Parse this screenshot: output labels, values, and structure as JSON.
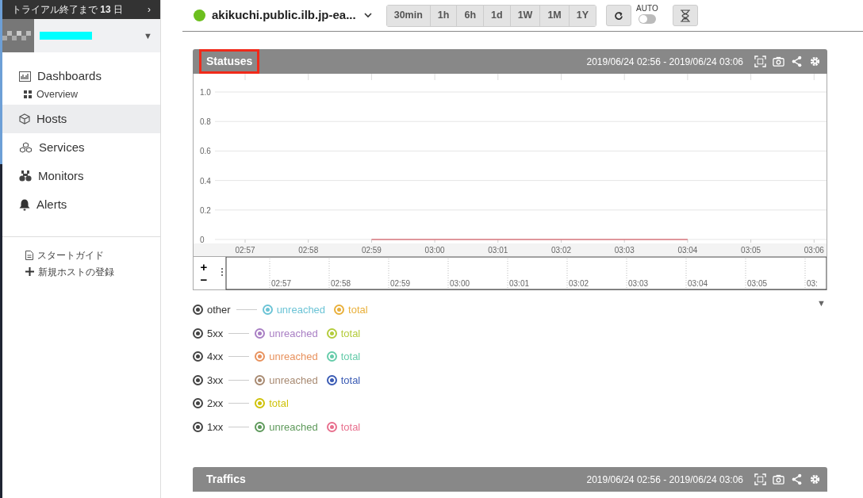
{
  "sidebar": {
    "trial_banner": "トライアル終了まで **13** 日",
    "trial_arrow": "›",
    "org_caret": "▼",
    "nav": [
      {
        "label": "Dashboards",
        "selected": false,
        "children": [
          {
            "label": "Overview",
            "selected": false
          }
        ]
      },
      {
        "label": "Hosts",
        "selected": true
      },
      {
        "label": "Services",
        "selected": false
      },
      {
        "label": "Monitors",
        "selected": false
      },
      {
        "label": "Alerts",
        "selected": false
      }
    ],
    "footer_links": [
      {
        "label": "スタートガイド"
      },
      {
        "label": "新規ホストの登録"
      }
    ]
  },
  "topbar": {
    "host": "akikuchi.public.ilb.jp-ea...",
    "ranges": [
      {
        "label": "30min",
        "selected": false
      },
      {
        "label": "1h",
        "selected": false
      },
      {
        "label": "6h",
        "selected": false
      },
      {
        "label": "1d",
        "selected": false
      },
      {
        "label": "1W",
        "selected": false
      },
      {
        "label": "1M",
        "selected": false
      },
      {
        "label": "1Y",
        "selected": false
      }
    ],
    "auto_label": "AUTO",
    "auto_on": false
  },
  "panels": [
    {
      "title": "Statuses",
      "highlighted": true,
      "range": "2019/06/24 02:56 - 2019/06/24 03:06",
      "chart_data": {
        "type": "line",
        "grid": true,
        "x": [
          "02:57",
          "02:58",
          "02:59",
          "03:00",
          "03:01",
          "03:02",
          "03:03",
          "03:04",
          "03:05",
          "03:06"
        ],
        "yticks": [
          {
            "value": 0,
            "label": "0"
          },
          {
            "value": 0.2,
            "label": "0.2"
          },
          {
            "value": 0.4,
            "label": "0.4"
          },
          {
            "value": 0.6,
            "label": "0.6"
          },
          {
            "value": 0.8,
            "label": "0.8"
          },
          {
            "value": 1,
            "label": "1.0"
          }
        ],
        "ylim": [
          0,
          1
        ],
        "series": [
          {
            "color": "#d9777f",
            "values": [
              null,
              null,
              0,
              0,
              0,
              0,
              0,
              0,
              null,
              null
            ]
          }
        ]
      },
      "navigator": {
        "zoom_in": "+",
        "zoom_out": "−",
        "ticks": [
          "02:57",
          "02:58",
          "02:59",
          "03:00",
          "03:01",
          "03:02",
          "03:03",
          "03:04",
          "03:05",
          "03:"
        ]
      },
      "legend_toggle": "▼",
      "legend": [
        {
          "group": "other",
          "on": true,
          "items": [
            {
              "label": "unreached",
              "color": "#6cc4d6",
              "on": true
            },
            {
              "label": "total",
              "color": "#e9b03c",
              "on": true
            }
          ]
        },
        {
          "group": "5xx",
          "on": true,
          "items": [
            {
              "label": "unreached",
              "color": "#a97fc4",
              "on": true
            },
            {
              "label": "total",
              "color": "#b4cc3c",
              "on": true
            }
          ]
        },
        {
          "group": "4xx",
          "on": true,
          "items": [
            {
              "label": "unreached",
              "color": "#e8925e",
              "on": true
            },
            {
              "label": "total",
              "color": "#66ccaa",
              "on": true
            }
          ]
        },
        {
          "group": "3xx",
          "on": true,
          "items": [
            {
              "label": "unreached",
              "color": "#a88a72",
              "on": true
            },
            {
              "label": "total",
              "color": "#3a5bb4",
              "on": true
            }
          ]
        },
        {
          "group": "2xx",
          "on": true,
          "items": [
            {
              "label": "total",
              "color": "#cfc20a",
              "on": true
            }
          ]
        },
        {
          "group": "1xx",
          "on": true,
          "items": [
            {
              "label": "unreached",
              "color": "#5f9a5c",
              "on": true
            },
            {
              "label": "total",
              "color": "#e8708e",
              "on": true
            }
          ]
        }
      ]
    },
    {
      "title": "Traffics",
      "highlighted": false,
      "range": "2019/06/24 02:56 - 2019/06/24 03:06"
    }
  ]
}
